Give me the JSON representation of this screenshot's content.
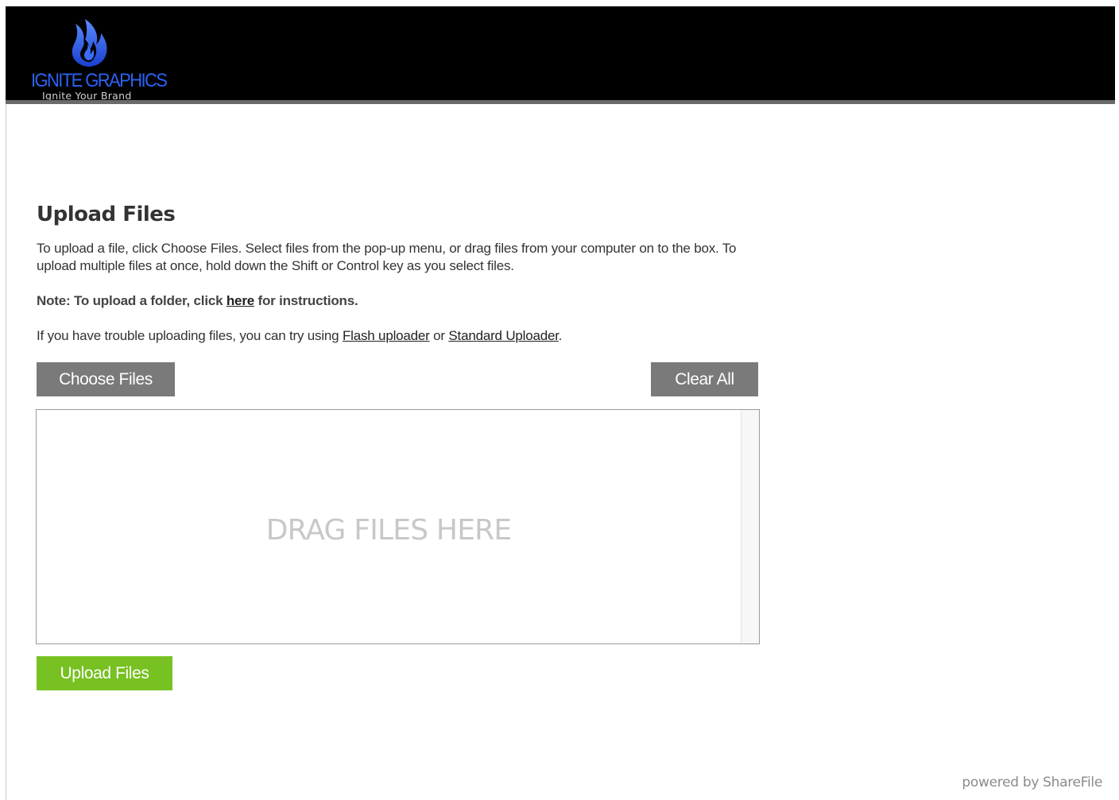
{
  "header": {
    "logo_name": "IGNITE GRAPHICS",
    "logo_tagline": "Ignite Your Brand",
    "logo_icon": "flame-icon",
    "colors": {
      "background": "#000000",
      "logo_blue": "#2b62f2",
      "bottom_bar": "#6b6b6b"
    }
  },
  "main": {
    "title": "Upload Files",
    "instructions": "To upload a file, click Choose Files. Select files from the pop-up menu, or drag files from your computer on to the box. To upload multiple files at once, hold down the Shift or Control key as you select files.",
    "note": {
      "prefix": "Note: To upload a folder, click ",
      "link": "here",
      "suffix": " for instructions."
    },
    "trouble": {
      "prefix": "If you have trouble uploading files, you can try using ",
      "flash_link": "Flash uploader",
      "middle": " or ",
      "standard_link": "Standard Uploader",
      "suffix": "."
    },
    "choose_files_label": "Choose Files",
    "clear_all_label": "Clear All",
    "drop_zone_label": "DRAG FILES HERE",
    "upload_label": "Upload Files"
  },
  "footer": {
    "powered_by": "powered by ShareFile"
  },
  "colors": {
    "gray_button": "#7a7a7a",
    "upload_button": "#77c122",
    "drop_text": "#c8c8c8"
  }
}
